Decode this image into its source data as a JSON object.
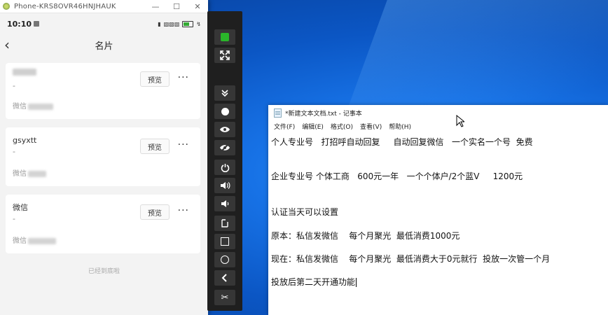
{
  "phone_window": {
    "title": "Phone-KRS8OVR46HNJHAUK",
    "status_time": "10:10",
    "page_title": "名片",
    "cards": [
      {
        "name": "",
        "dash": "-",
        "sub_label": "微信",
        "preview": "预览",
        "more": "···"
      },
      {
        "name": "gsyxtt",
        "dash": "-",
        "sub_label": "微信",
        "preview": "预览",
        "more": "···"
      },
      {
        "name": "微信",
        "dash": "-",
        "sub_label": "微信",
        "preview": "预览",
        "more": "···"
      }
    ],
    "footer_note": "已经到底啦"
  },
  "toolbar": {
    "buttons": [
      "power-indicator-icon",
      "fullscreen-icon",
      "collapse-icon",
      "record-icon",
      "eye-icon",
      "eye-off-icon",
      "power-icon",
      "volume-up-icon",
      "volume-down-icon",
      "rotate-icon",
      "home-square-icon",
      "circle-icon",
      "back-icon",
      "scissors-icon"
    ]
  },
  "notepad": {
    "title": "*新建文本文档.txt - 记事本",
    "menu": [
      "文件(F)",
      "编辑(E)",
      "格式(O)",
      "查看(V)",
      "帮助(H)"
    ],
    "lines": [
      "个人专业号   打招呼自动回复     自动回复微信   一个实名一个号  免费",
      "企业专业号 个体工商   600元一年   一个个体户/2个蓝V     1200元",
      "认证当天可以设置",
      "原本：私信发微信    每个月聚光  最低消费1000元",
      "现在：私信发微信    每个月聚光  最低消费大于0元就行  投放一次管一个月",
      "投放后第二天开通功能"
    ]
  },
  "colors": {
    "desktop_blue": "#1772e6",
    "toolbar_bg": "#1f1f1f",
    "green_indicator": "#2ab52a"
  }
}
